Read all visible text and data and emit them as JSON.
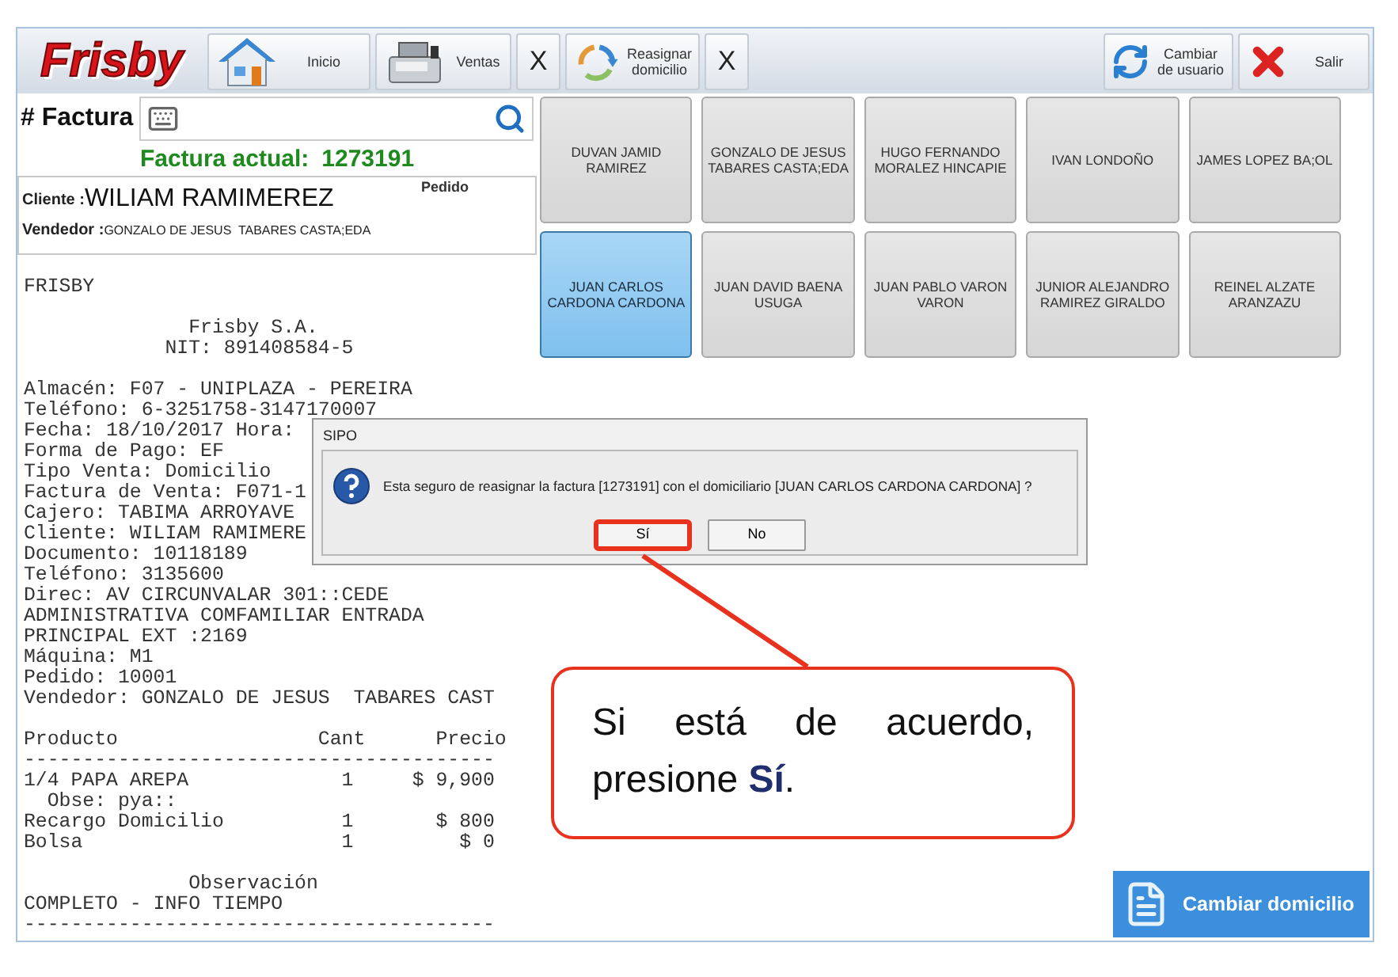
{
  "toolbar": {
    "logo": "Frisby",
    "buttons": [
      {
        "label": "Inicio",
        "kind": "home"
      },
      {
        "label": "Ventas",
        "kind": "sales"
      },
      {
        "label": "X",
        "kind": "close"
      },
      {
        "label": "Reasignar domicilio",
        "kind": "reassign"
      },
      {
        "label": "X",
        "kind": "close"
      }
    ],
    "right_buttons": [
      {
        "label": "Cambiar de usuario",
        "kind": "switch"
      },
      {
        "label": "Salir",
        "kind": "exit"
      }
    ]
  },
  "invoice": {
    "label": "# Factura",
    "current_label": "Factura actual:",
    "current": "1273191",
    "client_label": "Cliente :",
    "client": "WILIAM RAMIMEREZ",
    "order_label": "Pedido",
    "seller_label": "Vendedor :",
    "seller": "GONZALO DE JESUS  TABARES CASTA;EDA"
  },
  "receipt": [
    [
      "FRISBY"
    ],
    [
      "              Frisby S.A.",
      "            NIT: 891408584-5"
    ],
    [
      "Almacén: F07 - UNIPLAZA - PEREIRA",
      "Teléfono: 6-3251758-3147170007",
      "Fecha: 18/10/2017 Hora:",
      "Forma de Pago: EF",
      "Tipo Venta: Domicilio",
      "Factura de Venta: F071-1",
      "Cajero: TABIMA ARROYAVE",
      "Cliente: WILIAM RAMIMERE",
      "Documento: 10118189",
      "Teléfono: 3135600",
      "Direc: AV CIRCUNVALAR 301::CEDE",
      "ADMINISTRATIVA COMFAMILIAR ENTRADA",
      "PRINCIPAL EXT :2169",
      "Máquina: M1",
      "Pedido: 10001",
      "Vendedor: GONZALO DE JESUS  TABARES CAST"
    ],
    [
      "Producto                 Cant      Precio",
      "----------------------------------------",
      "1/4 PAPA AREPA             1     $ 9,900",
      "  Obse: pya::",
      "Recargo Domicilio          1       $ 800",
      "Bolsa                      1         $ 0"
    ],
    [
      "              Observación",
      "COMPLETO - INFO TIEMPO",
      "----------------------------------------"
    ]
  ],
  "couriers": [
    {
      "name": "DUVAN JAMID RAMIREZ",
      "selected": false
    },
    {
      "name": "GONZALO DE JESUS TABARES CASTA;EDA",
      "selected": false
    },
    {
      "name": "HUGO FERNANDO MORALEZ HINCAPIE",
      "selected": false
    },
    {
      "name": "IVAN LONDOÑO",
      "selected": false
    },
    {
      "name": "JAMES  LOPEZ BA;OL",
      "selected": false
    },
    {
      "name": "JUAN CARLOS CARDONA CARDONA",
      "selected": true
    },
    {
      "name": "JUAN DAVID  BAENA USUGA",
      "selected": false
    },
    {
      "name": "JUAN PABLO VARON VARON",
      "selected": false
    },
    {
      "name": "JUNIOR ALEJANDRO RAMIREZ GIRALDO",
      "selected": false
    },
    {
      "name": "REINEL ALZATE ARANZAZU",
      "selected": false
    }
  ],
  "change_button": "Cambiar domicilio",
  "dialog": {
    "title": "SIPO",
    "message": "Esta seguro de reasignar la factura [1273191] con el domiciliario [JUAN CARLOS CARDONA CARDONA] ?",
    "buttons": [
      {
        "label": "Sí",
        "annotated": true
      },
      {
        "label": "No",
        "annotated": false
      }
    ]
  },
  "callout": {
    "text": "Si está de acuerdo, presione **Sí**."
  }
}
